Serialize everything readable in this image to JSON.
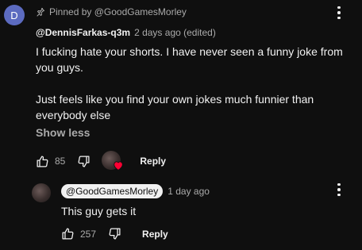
{
  "pinned_comment": {
    "avatar_letter": "D",
    "pin_icon": "pin-icon",
    "pinned_by": "Pinned by @GoodGamesMorley",
    "author": "@DennisFarkas-q3m",
    "time": "2 days ago (edited)",
    "text_paragraph_1": "I fucking hate your shorts. I have never seen a funny joke from you guys.",
    "text_paragraph_2": "Just feels like you find your own jokes much funnier than everybody else",
    "show_less": "Show less",
    "like_count": "85",
    "reply_label": "Reply",
    "hearted": true,
    "heart_color": "#ff0033"
  },
  "reply": {
    "author_chip": "@GoodGamesMorley",
    "time": "1 day ago",
    "text": "This guy gets it",
    "like_count": "257",
    "reply_label": "Reply"
  },
  "colors": {
    "background": "#0f0f0f",
    "text_primary": "#f1f1f1",
    "text_secondary": "#aaaaaa",
    "avatar_d": "#5c6bc0"
  }
}
